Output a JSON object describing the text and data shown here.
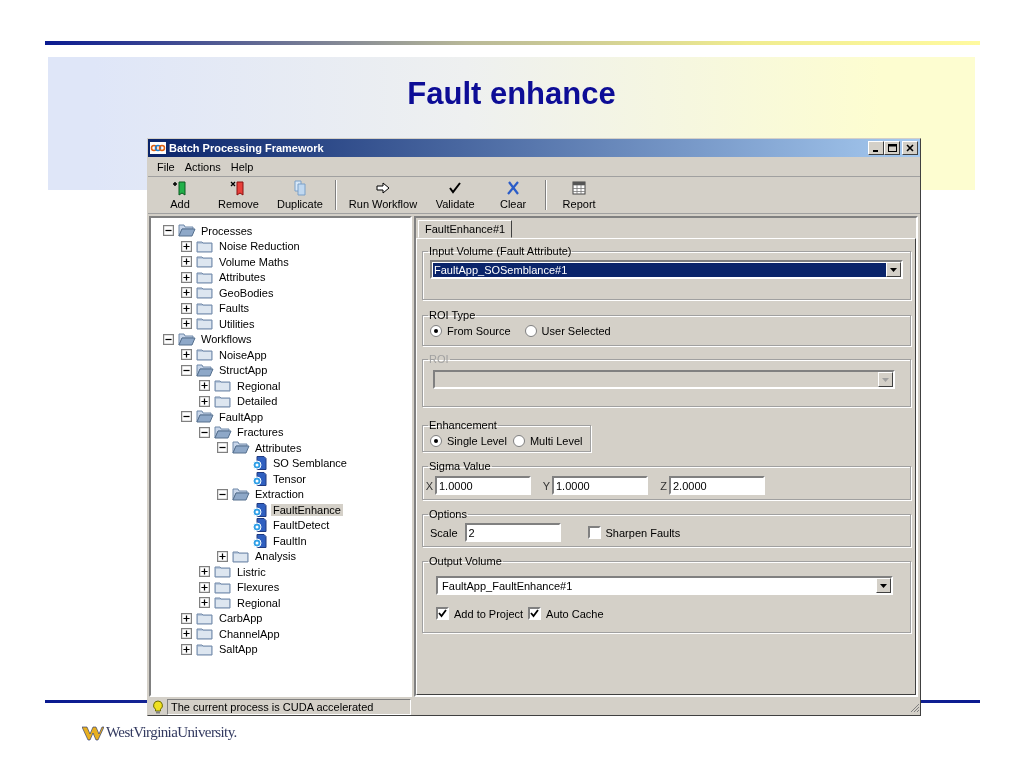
{
  "slide": {
    "title": "Fault enhance",
    "logo_text": "WestVirginiaUniversity."
  },
  "window": {
    "title": "Batch Processing Framework"
  },
  "menu": [
    {
      "label": "File"
    },
    {
      "label": "Actions"
    },
    {
      "label": "Help"
    }
  ],
  "toolbar": [
    [
      {
        "label": "Add",
        "kind": "add"
      },
      {
        "label": "Remove",
        "kind": "remove"
      },
      {
        "label": "Duplicate",
        "kind": "duplicate"
      }
    ],
    [
      {
        "label": "Run Workflow",
        "kind": "run"
      },
      {
        "label": "Validate",
        "kind": "validate"
      },
      {
        "label": "Clear",
        "kind": "clear"
      }
    ],
    [
      {
        "label": "Report",
        "kind": "report"
      }
    ]
  ],
  "tree": [
    {
      "label": "Processes",
      "kind": "folder",
      "expanded": true,
      "selected": false,
      "children": [
        {
          "label": "Noise Reduction",
          "kind": "folder",
          "expanded": false,
          "selected": false
        },
        {
          "label": "Volume Maths",
          "kind": "folder",
          "expanded": false,
          "selected": false
        },
        {
          "label": "Attributes",
          "kind": "folder",
          "expanded": false,
          "selected": false
        },
        {
          "label": "GeoBodies",
          "kind": "folder",
          "expanded": false,
          "selected": false
        },
        {
          "label": "Faults",
          "kind": "folder",
          "expanded": false,
          "selected": false
        },
        {
          "label": "Utilities",
          "kind": "folder",
          "expanded": false,
          "selected": false
        }
      ]
    },
    {
      "label": "Workflows",
      "kind": "folder",
      "expanded": true,
      "selected": false,
      "children": [
        {
          "label": "NoiseApp",
          "kind": "folder",
          "expanded": false,
          "selected": false
        },
        {
          "label": "StructApp",
          "kind": "folder",
          "expanded": true,
          "selected": false,
          "children": [
            {
              "label": "Regional",
              "kind": "folder",
              "expanded": false,
              "selected": false
            },
            {
              "label": "Detailed",
              "kind": "folder",
              "expanded": false,
              "selected": false
            }
          ]
        },
        {
          "label": "FaultApp",
          "kind": "folder",
          "expanded": true,
          "selected": false,
          "children": [
            {
              "label": "Fractures",
              "kind": "folder",
              "expanded": true,
              "selected": false,
              "children": [
                {
                  "label": "Attributes",
                  "kind": "folder",
                  "expanded": true,
                  "selected": false,
                  "children": [
                    {
                      "label": "SO Semblance",
                      "kind": "process",
                      "selected": false
                    },
                    {
                      "label": "Tensor",
                      "kind": "process",
                      "selected": false
                    }
                  ]
                },
                {
                  "label": "Extraction",
                  "kind": "folder",
                  "expanded": true,
                  "selected": false,
                  "children": [
                    {
                      "label": "FaultEnhance",
                      "kind": "process",
                      "selected": true
                    },
                    {
                      "label": "FaultDetect",
                      "kind": "process",
                      "selected": false
                    },
                    {
                      "label": "FaultIn",
                      "kind": "process",
                      "selected": false
                    }
                  ]
                },
                {
                  "label": "Analysis",
                  "kind": "folder",
                  "expanded": false,
                  "selected": false
                }
              ]
            },
            {
              "label": "Listric",
              "kind": "folder",
              "expanded": false,
              "selected": false
            },
            {
              "label": "Flexures",
              "kind": "folder",
              "expanded": false,
              "selected": false
            },
            {
              "label": "Regional",
              "kind": "folder",
              "expanded": false,
              "selected": false
            }
          ]
        },
        {
          "label": "CarbApp",
          "kind": "folder",
          "expanded": false,
          "selected": false
        },
        {
          "label": "ChannelApp",
          "kind": "folder",
          "expanded": false,
          "selected": false
        },
        {
          "label": "SaltApp",
          "kind": "folder",
          "expanded": false,
          "selected": false
        }
      ]
    }
  ],
  "tabs": [
    {
      "label": "FaultEnhance#1",
      "selected": true
    }
  ],
  "input_volume": {
    "title": "Input Volume (Fault Attribute)",
    "value": "FaultApp_SOSemblance#1",
    "highlighted": true
  },
  "roi_type": {
    "title": "ROI Type",
    "options": [
      {
        "label": "From Source",
        "selected": true
      },
      {
        "label": "User Selected",
        "selected": false
      }
    ]
  },
  "roi": {
    "title": "ROI",
    "disabled": true
  },
  "enhancement": {
    "title": "Enhancement",
    "options": [
      {
        "label": "Single Level",
        "selected": true
      },
      {
        "label": "Multi Level",
        "selected": false
      }
    ]
  },
  "sigma": {
    "title": "Sigma Value",
    "fields": [
      {
        "label": "X",
        "value": "1.0000"
      },
      {
        "label": "Y",
        "value": "1.0000"
      },
      {
        "label": "Z",
        "value": "2.0000"
      }
    ]
  },
  "options": {
    "title": "Options",
    "scale": {
      "label": "Scale",
      "value": "2"
    },
    "sharpen": {
      "label": "Sharpen Faults",
      "checked": false
    }
  },
  "output_volume": {
    "title": "Output Volume",
    "value": "FaultApp_FaultEnhance#1",
    "checkboxes": [
      {
        "label": "Add to Project",
        "checked": true
      },
      {
        "label": "Auto Cache",
        "checked": true
      }
    ]
  },
  "status_bar": {
    "text": "The current process is CUDA accelerated"
  }
}
